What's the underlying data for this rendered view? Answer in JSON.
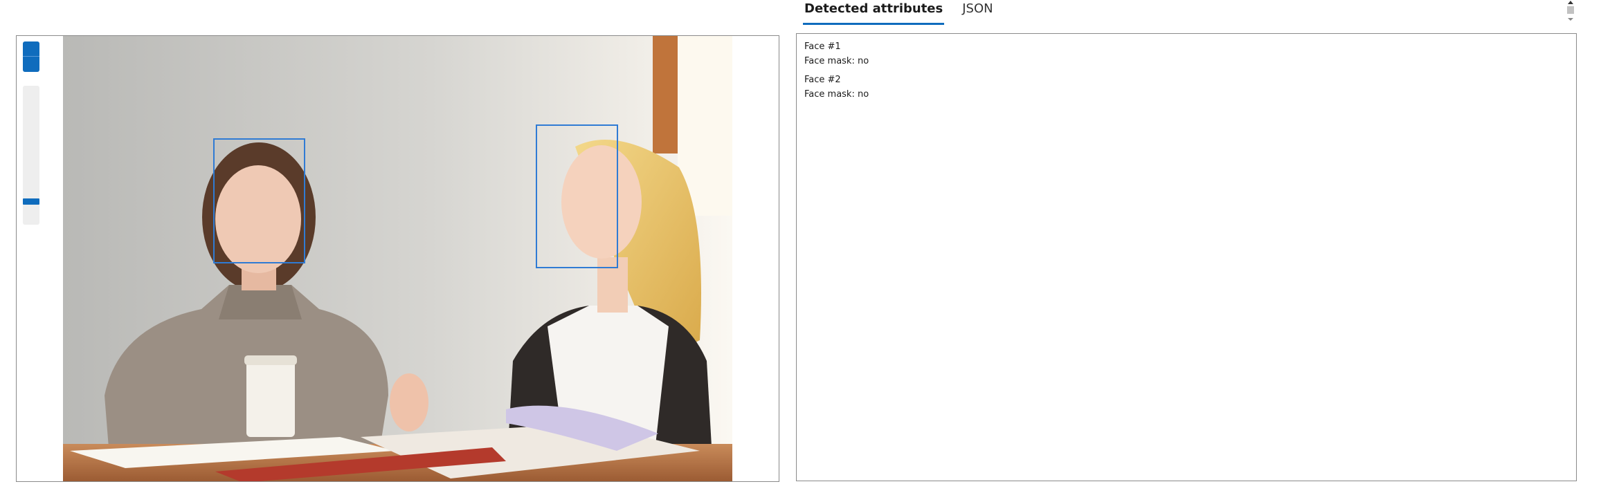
{
  "tabs": [
    {
      "label": "Detected attributes",
      "active": true
    },
    {
      "label": "JSON",
      "active": false
    }
  ],
  "viewer": {
    "zoom_in_icon": "plus-icon",
    "zoom_out_icon": "minus-icon",
    "zoom_level_fraction": 0.15
  },
  "faces": [
    {
      "title": "Face #1",
      "attribute": "Face mask: no"
    },
    {
      "title": "Face #2",
      "attribute": "Face mask: no"
    }
  ],
  "colors": {
    "accent": "#0f6cbd",
    "face_box": "#2f7bd4",
    "panel_border": "#8a8a8a"
  }
}
